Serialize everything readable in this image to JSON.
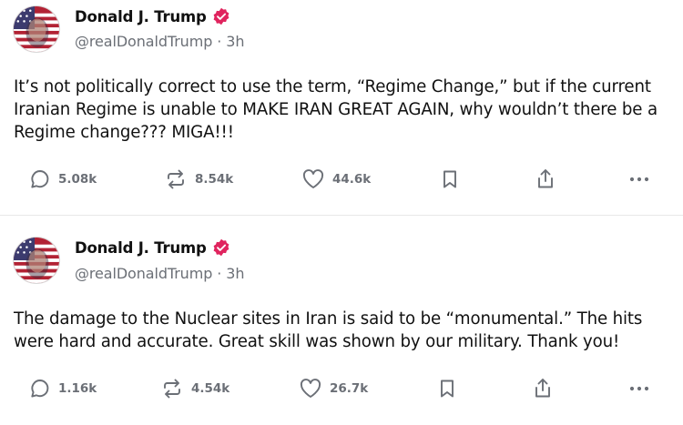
{
  "colors": {
    "text": "#111111",
    "muted": "#6b6f76",
    "verified_badge": "#e0245e",
    "divider": "#e7e7e7"
  },
  "posts": [
    {
      "author": {
        "display_name": "Donald J. Trump",
        "handle": "@realDonaldTrump",
        "time": "3h",
        "verified": true
      },
      "text": "It’s not politically correct to use the term, “Regime Change,” but if the current Iranian Regime is unable to MAKE IRAN GREAT AGAIN, why wouldn’t there be a Regime change??? MIGA!!!",
      "stats": {
        "replies": "5.08k",
        "reposts": "8.54k",
        "likes": "44.6k"
      },
      "icons": [
        "reply-icon",
        "repost-icon",
        "like-icon",
        "bookmark-icon",
        "share-icon",
        "more-icon"
      ]
    },
    {
      "author": {
        "display_name": "Donald J. Trump",
        "handle": "@realDonaldTrump",
        "time": "3h",
        "verified": true
      },
      "text": "The damage to the Nuclear sites in Iran is said to be “monumental.” The hits were hard and accurate. Great skill was shown by our military. Thank you!",
      "stats": {
        "replies": "1.16k",
        "reposts": "4.54k",
        "likes": "26.7k"
      },
      "icons": [
        "reply-icon",
        "repost-icon",
        "like-icon",
        "bookmark-icon",
        "share-icon",
        "more-icon"
      ]
    }
  ],
  "meta_separator": "·"
}
